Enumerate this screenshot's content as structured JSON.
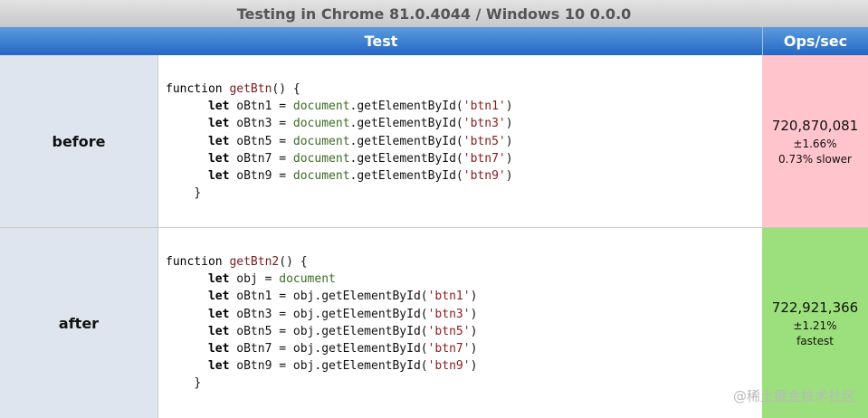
{
  "caption": "Testing in Chrome 81.0.4044 / Windows 10 0.0.0",
  "header": {
    "test_label": "Test",
    "ops_label": "Ops/sec"
  },
  "colors": {
    "slower": "#ffc4cc",
    "fastest": "#9be07c"
  },
  "rows": [
    {
      "label": "before",
      "code": {
        "l1_kw": "function ",
        "l1_fn": "getBtn",
        "l1_rest": "() {",
        "l2_kw": "let",
        "l2_var": " oBtn1 = ",
        "l2_doc": "document",
        "l2_call": ".getElementById(",
        "l2_str": "'btn1'",
        "l2_end": ")",
        "l3_kw": "let",
        "l3_var": " oBtn3 = ",
        "l3_doc": "document",
        "l3_call": ".getElementById(",
        "l3_str": "'btn3'",
        "l3_end": ")",
        "l4_kw": "let",
        "l4_var": " oBtn5 = ",
        "l4_doc": "document",
        "l4_call": ".getElementById(",
        "l4_str": "'btn5'",
        "l4_end": ")",
        "l5_kw": "let",
        "l5_var": " oBtn7 = ",
        "l5_doc": "document",
        "l5_call": ".getElementById(",
        "l5_str": "'btn7'",
        "l5_end": ")",
        "l6_kw": "let",
        "l6_var": " oBtn9 = ",
        "l6_doc": "document",
        "l6_call": ".getElementById(",
        "l6_str": "'btn9'",
        "l6_end": ")",
        "l7": "}"
      },
      "ops": "720,870,081",
      "margin": "±1.66%",
      "verdict": "0.73% slower"
    },
    {
      "label": "after",
      "code": {
        "l1_kw": "function ",
        "l1_fn": "getBtn2",
        "l1_rest": "() {",
        "l2_kw": "let",
        "l2_var": " obj = ",
        "l2_doc": "document",
        "l3_kw": "let",
        "l3_var": " oBtn1 = obj.getElementById(",
        "l3_str": "'btn1'",
        "l3_end": ")",
        "l4_kw": "let",
        "l4_var": " oBtn3 = obj.getElementById(",
        "l4_str": "'btn3'",
        "l4_end": ")",
        "l5_kw": "let",
        "l5_var": " oBtn5 = obj.getElementById(",
        "l5_str": "'btn5'",
        "l5_end": ")",
        "l6_kw": "let",
        "l6_var": " oBtn7 = obj.getElementById(",
        "l6_str": "'btn7'",
        "l6_end": ")",
        "l7_kw": "let",
        "l7_var": " oBtn9 = obj.getElementById(",
        "l7_str": "'btn9'",
        "l7_end": ")",
        "l8": "}"
      },
      "ops": "722,921,366",
      "margin": "±1.21%",
      "verdict": "fastest"
    }
  ],
  "watermark": "@稀土掘金技术社区"
}
